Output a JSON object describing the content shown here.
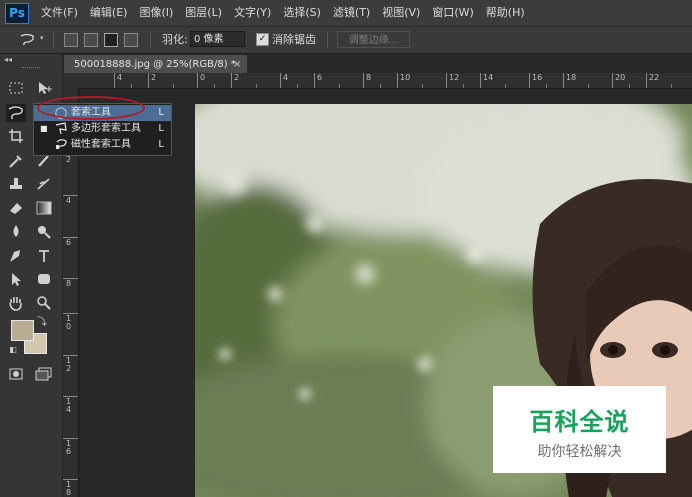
{
  "app": {
    "logo_text": "Ps"
  },
  "menu": [
    "文件(F)",
    "编辑(E)",
    "图像(I)",
    "图层(L)",
    "文字(Y)",
    "选择(S)",
    "滤镜(T)",
    "视图(V)",
    "窗口(W)",
    "帮助(H)"
  ],
  "options": {
    "tool_icon": "lasso-icon",
    "feather_label": "羽化:",
    "feather_value": "0 像素",
    "antialias_checked": true,
    "antialias_label": "消除锯齿",
    "refine_edge_label": "调整边缘..."
  },
  "tools_panel": {
    "collapse_glyph": "◂◂"
  },
  "flyout": {
    "items": [
      {
        "label": "套索工具",
        "shortcut": "L",
        "icon": "lasso-icon",
        "active": true
      },
      {
        "label": "多边形套索工具",
        "shortcut": "L",
        "icon": "polygonal-lasso-icon",
        "active": false
      },
      {
        "label": "磁性套索工具",
        "shortcut": "L",
        "icon": "magnetic-lasso-icon",
        "active": false
      }
    ],
    "current_marker": "■"
  },
  "document": {
    "tab_title": "500018888.jpg @ 25%(RGB/8) *",
    "close_glyph": "×",
    "ruler_h_labels": [
      "4",
      "2",
      "0",
      "2",
      "4",
      "6",
      "8",
      "10",
      "12",
      "14",
      "16",
      "18",
      "20",
      "22"
    ],
    "ruler_v_labels": [
      "2",
      "4",
      "6",
      "8",
      "10",
      "12",
      "14",
      "16",
      "18"
    ]
  },
  "colors": {
    "foreground": "#bbac94",
    "background": "#d4c6ab",
    "accent": "#31a8ff",
    "highlight": "#b3192a"
  },
  "watermark": {
    "title": "百科全说",
    "subtitle": "助你轻松解决"
  }
}
